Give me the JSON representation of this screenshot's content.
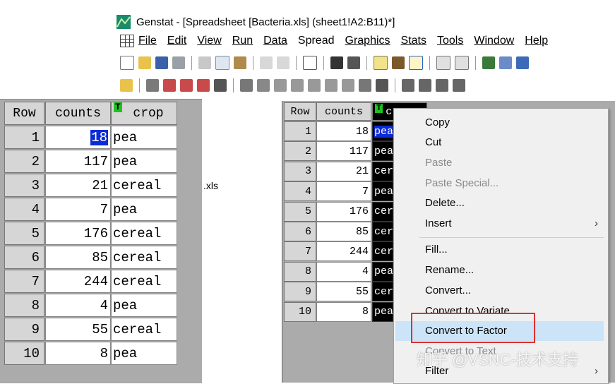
{
  "window": {
    "app_name": "Genstat",
    "title_rest": " - [Spreadsheet [Bacteria.xls] (sheet1!A2:B11)*]"
  },
  "menu": [
    "File",
    "Edit",
    "View",
    "Run",
    "Data",
    "Spread",
    "Graphics",
    "Stats",
    "Tools",
    "Window",
    "Help"
  ],
  "columns": {
    "row": "Row",
    "counts": "counts",
    "crop": "crop",
    "crop_type_badge": "T"
  },
  "rows": [
    {
      "row": "1",
      "counts": "18",
      "crop": "pea"
    },
    {
      "row": "2",
      "counts": "117",
      "crop": "pea"
    },
    {
      "row": "3",
      "counts": "21",
      "crop": "cereal"
    },
    {
      "row": "4",
      "counts": "7",
      "crop": "pea"
    },
    {
      "row": "5",
      "counts": "176",
      "crop": "cereal"
    },
    {
      "row": "6",
      "counts": "85",
      "crop": "cereal"
    },
    {
      "row": "7",
      "counts": "244",
      "crop": "cereal"
    },
    {
      "row": "8",
      "counts": "4",
      "crop": "pea"
    },
    {
      "row": "9",
      "counts": "55",
      "crop": "cereal"
    },
    {
      "row": "10",
      "counts": "8",
      "crop": "pea"
    }
  ],
  "right_crop_visible": [
    "pea",
    "pea",
    "cer",
    "pea",
    "cer",
    "cer",
    "cer",
    "pea",
    "cer",
    "pea"
  ],
  "right_header_crop": "c",
  "background_text": ".xls",
  "context_menu": {
    "copy": "Copy",
    "cut": "Cut",
    "paste": "Paste",
    "paste_special": "Paste Special...",
    "delete": "Delete...",
    "insert": "Insert",
    "fill": "Fill...",
    "rename": "Rename...",
    "convert": "Convert...",
    "convert_variate": "Convert to Variate",
    "convert_factor": "Convert to Factor",
    "convert_text": "Convert to Text",
    "filter": "Filter",
    "submenu_arrow": "›"
  },
  "watermark": "知乎 @VSNC-技术支持",
  "colors": {
    "selection": "#0b2bd6",
    "highlight_box": "#e03030",
    "menu_hover": "#cce4f7"
  }
}
